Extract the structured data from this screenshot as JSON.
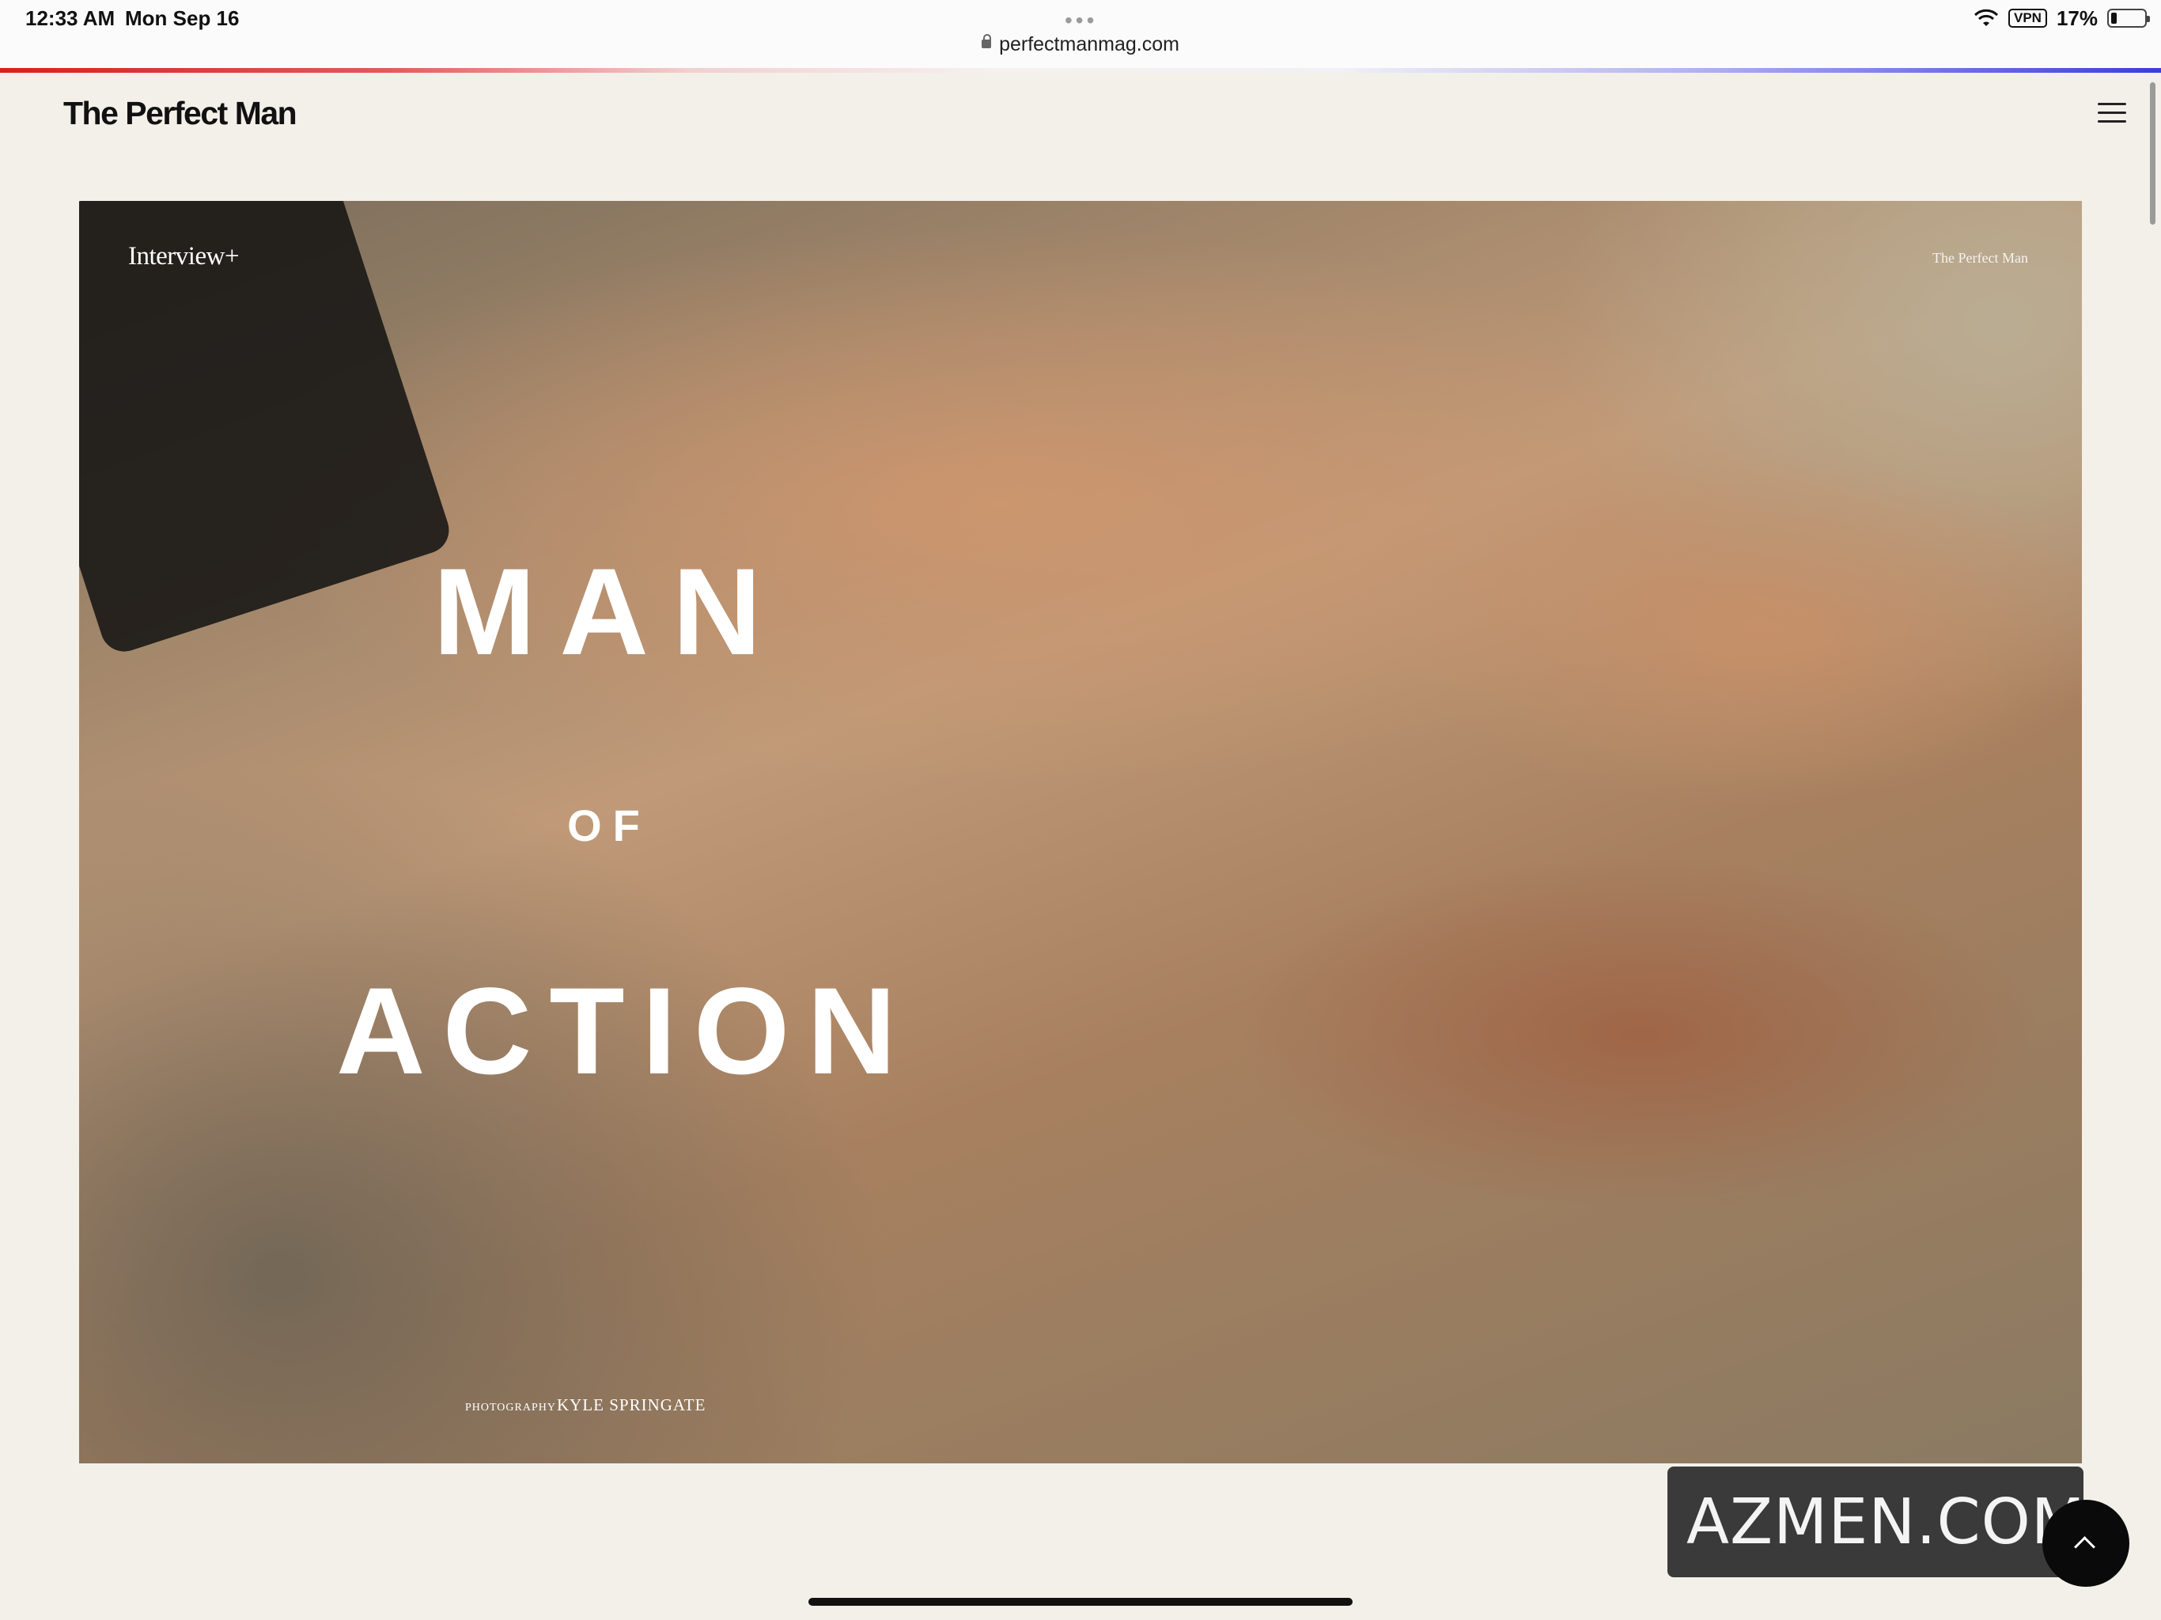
{
  "status": {
    "time": "12:33 AM",
    "date": "Mon Sep 16",
    "url": "perfectmanmag.com",
    "vpn": "VPN",
    "battery": "17%",
    "battery_level": 0.17,
    "icons": [
      "lock-icon",
      "wifi-icon",
      "battery-icon",
      "tab-dots-icon"
    ]
  },
  "site": {
    "logo": "The Perfect Man",
    "menu_icon": "hamburger-menu-icon"
  },
  "hero": {
    "section_label": "Interview+",
    "brand_mark": "The Perfect Man",
    "title_line1": "MAN",
    "title_line2": "OF",
    "title_line3": "ACTION",
    "credit_label": "PHOTOGRAPHY",
    "credit_name": "KYLE SPRINGATE",
    "image_description_icon": "photo-image"
  },
  "watermark": {
    "text": "AZMEN.COM"
  },
  "controls": {
    "scroll_top_icon": "chevron-up-icon"
  },
  "colors": {
    "page_background": "#f3f0ea",
    "text": "#111111",
    "progress_start": "#d91e1e",
    "progress_end": "#3b3be0",
    "scroll_button": "#0a0a0a",
    "watermark_bg": "#3a3a3a"
  }
}
